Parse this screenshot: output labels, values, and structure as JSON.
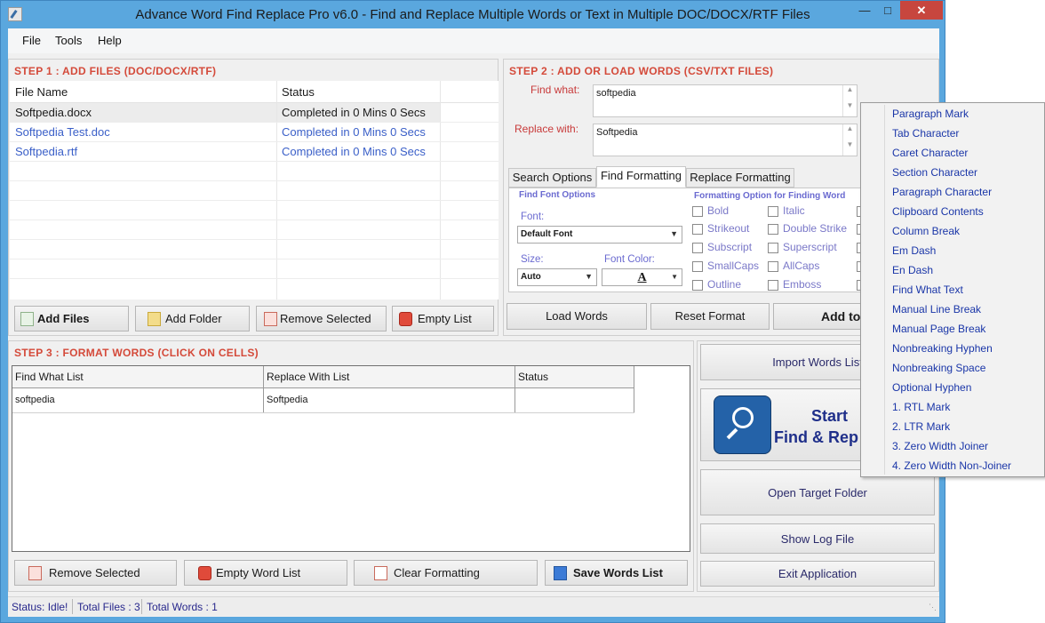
{
  "window": {
    "title": "Advance Word Find Replace Pro v6.0 - Find and Replace Multiple Words or Text in Multiple DOC/DOCX/RTF Files"
  },
  "menu": [
    "File",
    "Tools",
    "Help"
  ],
  "step1": {
    "title": "STEP 1 : ADD FILES (DOC/DOCX/RTF)",
    "columns": [
      "File Name",
      "Status"
    ],
    "rows": [
      {
        "name": "Softpedia.docx",
        "status": "Completed in 0 Mins 0 Secs"
      },
      {
        "name": "Softpedia Test.doc",
        "status": "Completed in 0 Mins 0 Secs"
      },
      {
        "name": "Softpedia.rtf",
        "status": "Completed in 0 Mins 0 Secs"
      }
    ],
    "buttons": {
      "add_files": "Add Files",
      "add_folder": "Add Folder",
      "remove_selected": "Remove Selected",
      "empty_list": "Empty List"
    }
  },
  "step2": {
    "title": "STEP 2 : ADD OR LOAD WORDS (CSV/TXT FILES)",
    "find_label": "Find what:",
    "find_value": "softpedia",
    "replace_label": "Replace with:",
    "replace_value": "Softpedia",
    "tabs": [
      "Search Options",
      "Find Formatting",
      "Replace Formatting"
    ],
    "font_options_title": "Find Font Options",
    "font_label": "Font:",
    "font_value": "Default Font",
    "size_label": "Size:",
    "size_value": "Auto",
    "font_color_label": "Font Color:",
    "font_color_glyph": "A",
    "format_title": "Formatting Option for Finding Word",
    "options_left": [
      "Bold",
      "Strikeout",
      "Subscript",
      "SmallCaps",
      "Outline"
    ],
    "options_right": [
      "Italic",
      "Double Strike",
      "Superscript",
      "AllCaps",
      "Emboss"
    ],
    "buttons": {
      "load_words": "Load Words",
      "reset_format": "Reset Format",
      "add_to": "Add to"
    }
  },
  "step3": {
    "title": "STEP 3 : FORMAT WORDS (CLICK ON CELLS)",
    "columns": [
      "Find What List",
      "Replace With List",
      "Status"
    ],
    "rows": [
      {
        "find": "softpedia",
        "replace": "Softpedia",
        "status": ""
      }
    ],
    "buttons": {
      "remove_selected": "Remove Selected",
      "empty_word_list": "Empty Word List",
      "clear_formatting": "Clear Formatting",
      "save_words_list": "Save Words List"
    }
  },
  "side": {
    "import_words": "Import Words List",
    "start_line1": "Start",
    "start_line2": "Find & Rep",
    "open_target": "Open Target Folder",
    "show_log": "Show Log File",
    "exit": "Exit Application"
  },
  "status": {
    "status": "Status:  Idle!",
    "total_files": "Total Files : 3",
    "total_words": "Total Words : 1"
  },
  "special_menu": [
    "Paragraph Mark",
    "Tab Character",
    "Caret Character",
    "Section Character",
    "Paragraph Character",
    "Clipboard Contents",
    "Column Break",
    "Em Dash",
    "En Dash",
    "Find What Text",
    "Manual Line Break",
    "Manual Page Break",
    "Nonbreaking Hyphen",
    "Nonbreaking Space",
    "Optional Hyphen",
    "1. RTL Mark",
    "2. LTR Mark",
    "3. Zero Width Joiner",
    "4. Zero Width Non-Joiner"
  ],
  "colors": {
    "title_bar": "#5aa7de",
    "group_title": "#d44a3a",
    "link_text": "#3a5fc8",
    "status_text": "#27278c"
  }
}
